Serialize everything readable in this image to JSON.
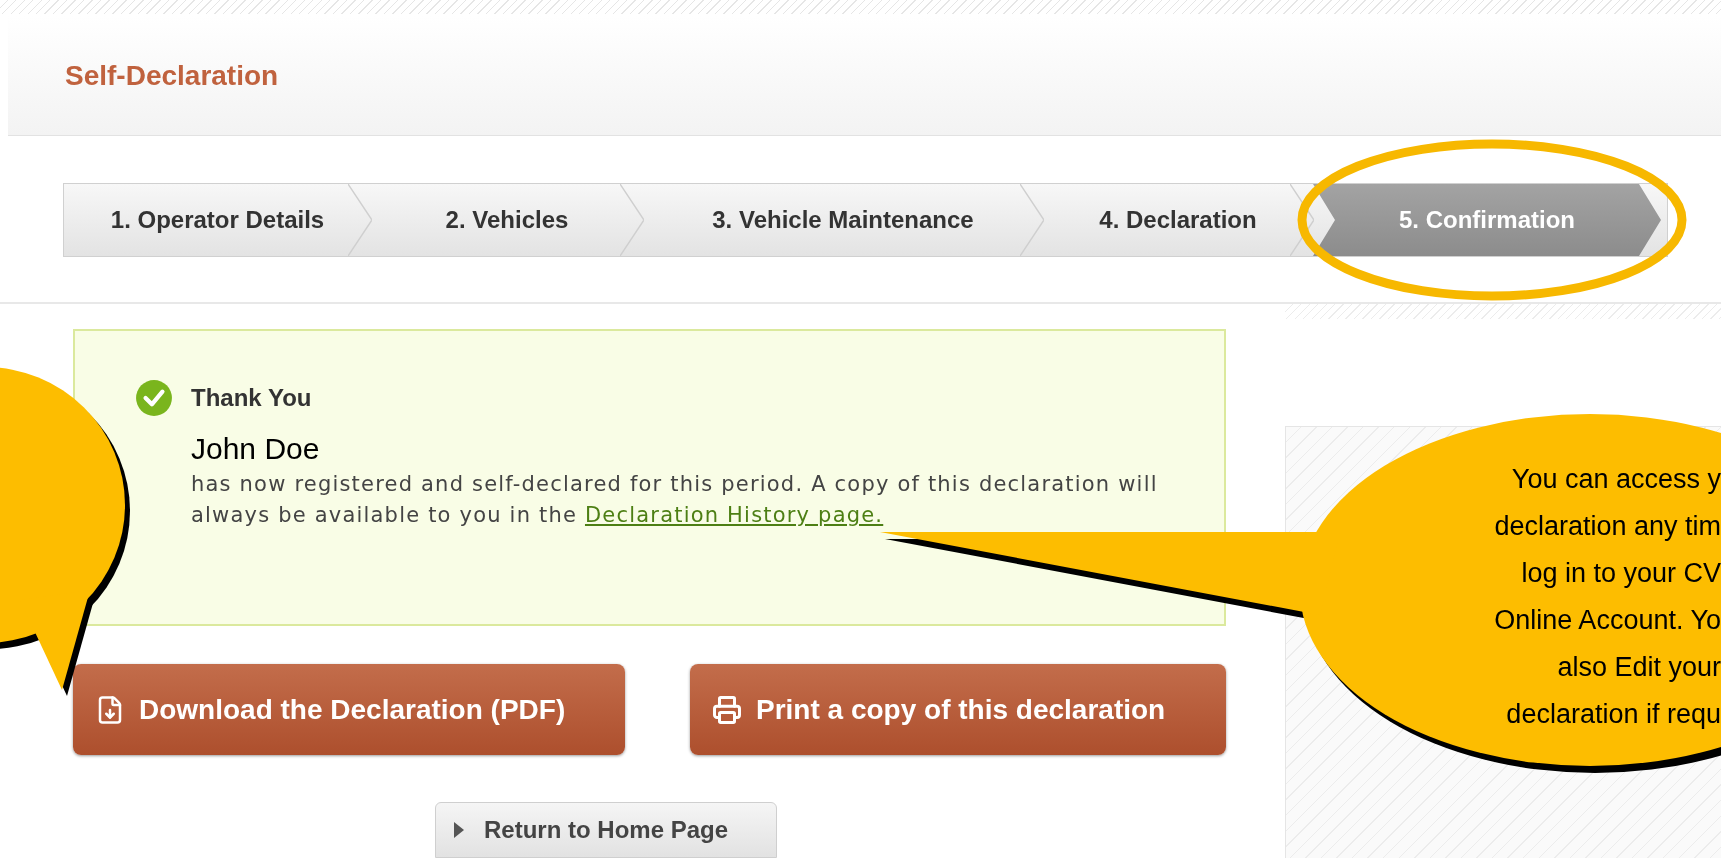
{
  "header": {
    "title": "Self-Declaration"
  },
  "steps": [
    {
      "label": "1. Operator Details",
      "selected": false
    },
    {
      "label": "2. Vehicles",
      "selected": false
    },
    {
      "label": "3. Vehicle Maintenance",
      "selected": false
    },
    {
      "label": "4. Declaration",
      "selected": false
    },
    {
      "label": "5. Confirmation",
      "selected": true
    }
  ],
  "confirmation": {
    "title": "Thank You",
    "name": "John Doe",
    "message": "has now registered and self-declared for this period. A copy of this declaration will always be available to you in the ",
    "link": "Declaration History page."
  },
  "actions": [
    {
      "kind": "download",
      "label": "Download the Declaration (PDF)"
    },
    {
      "kind": "print",
      "label": "Print a copy of this declaration"
    }
  ],
  "return_button": "Return to Home Page",
  "callout": {
    "lines": [
      "You can access y",
      "declaration any tim",
      "log in to your CV",
      "Online Account. Yo",
      "also Edit your",
      "declaration if requ"
    ]
  }
}
